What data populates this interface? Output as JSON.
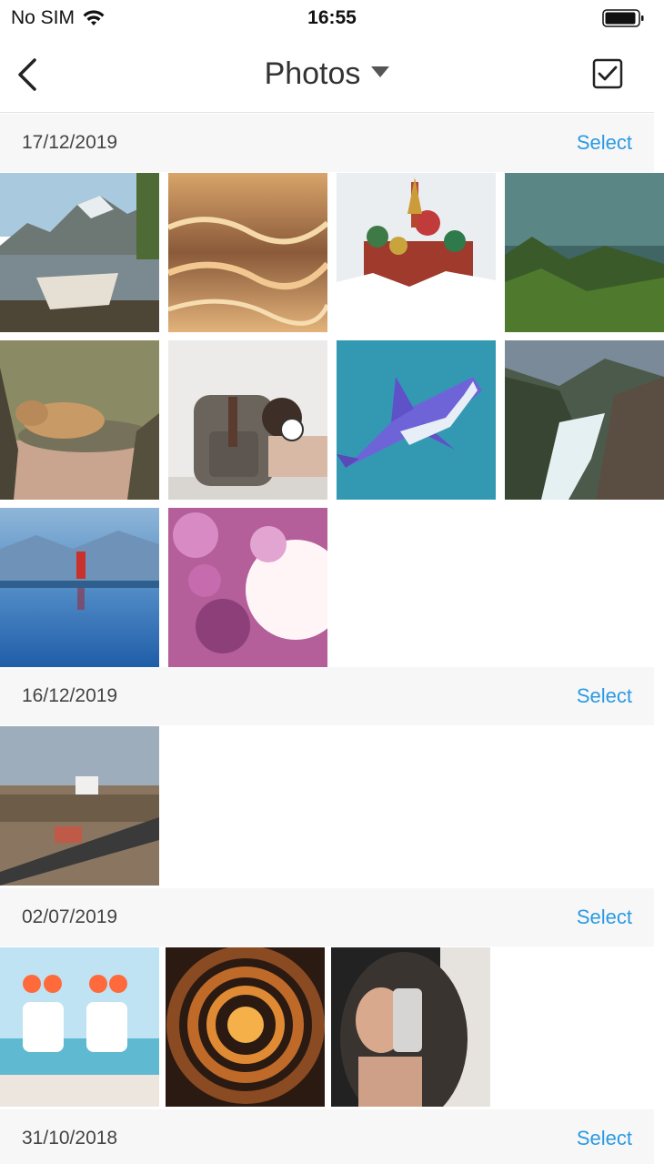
{
  "status": {
    "carrier": "No SIM",
    "time": "16:55",
    "wifi_icon": "wifi-icon",
    "battery_icon": "battery-icon"
  },
  "nav": {
    "title": "Photos",
    "back_icon": "chevron-left-icon",
    "title_dropdown_icon": "caret-down-icon",
    "select_mode_icon": "checkbox-checked-icon"
  },
  "sections": [
    {
      "date": "17/12/2019",
      "select_label": "Select",
      "photos": [
        "lake-boat-mountains",
        "golden-water-ripples",
        "st-basils-cathedral-snow",
        "green-grass-fog",
        "lioness-drinking",
        "woman-with-backpack",
        "shark-illustration",
        "mountain-river-rapids",
        "person-reflection-lake",
        "pink-blossoms-sunlight"
      ]
    },
    {
      "date": "16/12/2019",
      "select_label": "Select",
      "photos": [
        "city-aerial-view"
      ]
    },
    {
      "date": "02/07/2019",
      "select_label": "Select",
      "photos": [
        "two-friends-beach",
        "tunnel-sunset",
        "mirror-selfie"
      ]
    },
    {
      "date": "31/10/2018",
      "select_label": "Select",
      "photos": []
    }
  ],
  "colors": {
    "accent": "#2a9ae2",
    "section_bg": "#f7f7f7"
  }
}
